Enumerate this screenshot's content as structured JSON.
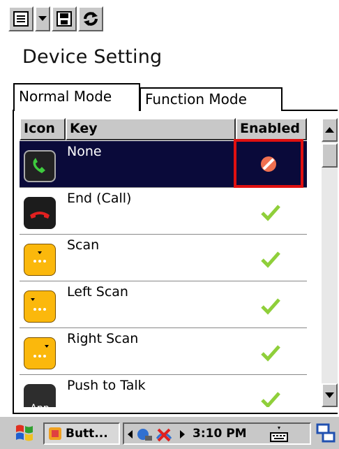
{
  "app": {
    "title": "Device Setting",
    "tabs": [
      {
        "label": "Normal Mode",
        "active": true
      },
      {
        "label": "Function Mode",
        "active": false
      }
    ]
  },
  "toolbar": {
    "icons": [
      "menu-icon",
      "dropdown-icon",
      "save-icon",
      "refresh-icon"
    ]
  },
  "table": {
    "headers": [
      "Icon",
      "Key",
      "Enabled"
    ],
    "rows": [
      {
        "key": "None",
        "icon": "phone-green-icon",
        "enabled": "disabled",
        "selected": true
      },
      {
        "key": "End (Call)",
        "icon": "phone-red-icon",
        "enabled": "enabled",
        "selected": false
      },
      {
        "key": "Scan",
        "icon": "scan-key-icon",
        "enabled": "enabled",
        "selected": false
      },
      {
        "key": "Left Scan",
        "icon": "left-scan-key-icon",
        "enabled": "enabled",
        "selected": false
      },
      {
        "key": "Right Scan",
        "icon": "right-scan-key-icon",
        "enabled": "enabled",
        "selected": false
      },
      {
        "key": "Push to Talk",
        "icon": "app-key-icon",
        "enabled": "enabled",
        "selected": false
      }
    ],
    "app_key_label": "App"
  },
  "taskbar": {
    "task_label": "Butt...",
    "clock": "3:10 PM"
  },
  "colors": {
    "selection_bg": "#0a0a3a",
    "highlight_border": "#e01010",
    "key_yellow": "#fbb80c",
    "check_green": "#8fcf3a"
  }
}
